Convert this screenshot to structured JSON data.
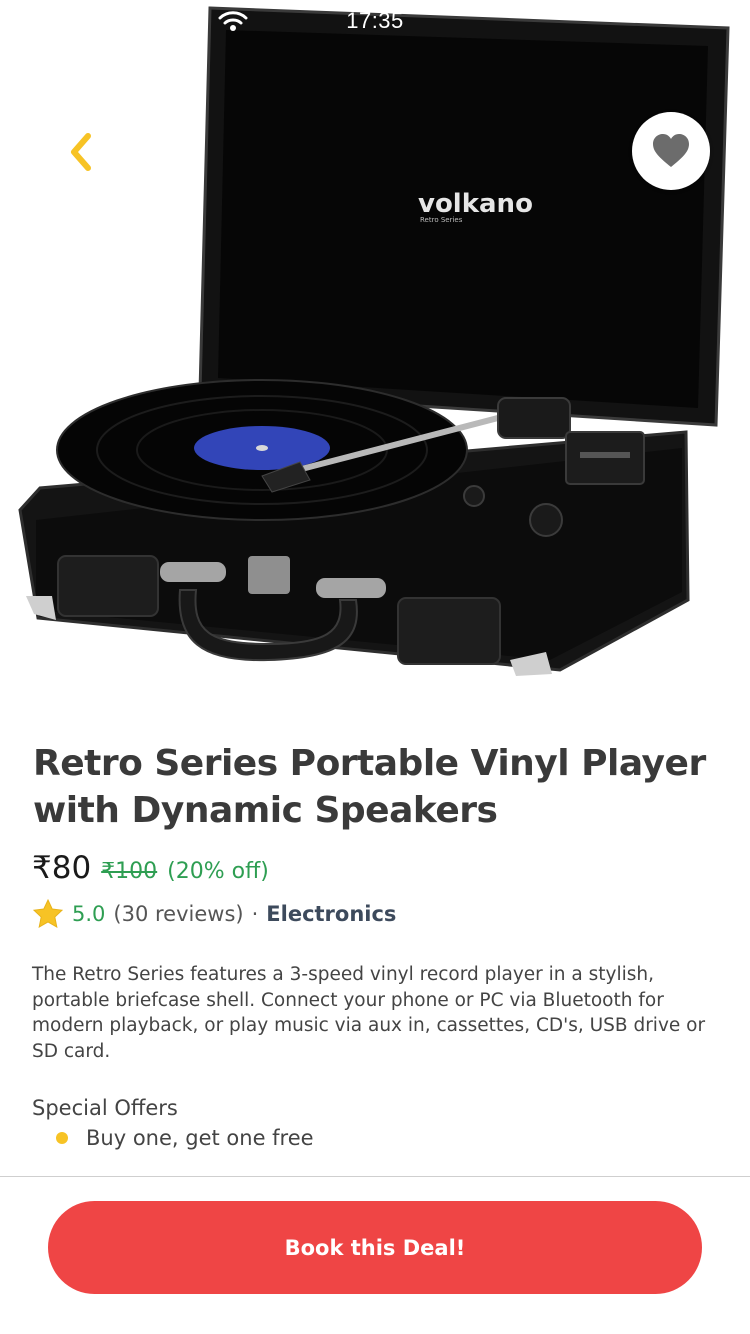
{
  "status_bar": {
    "time": "17:35"
  },
  "product": {
    "brand_logo": "volkano",
    "brand_sub": "Retro Series",
    "title": "Retro Series Portable Vinyl Player with Dynamic Speakers",
    "price": "₹80",
    "original_price": "₹100",
    "discount": "(20% off)",
    "rating": "5.0",
    "reviews": "(30 reviews)",
    "separator": "·",
    "category": "Electronics",
    "description": "The Retro Series features a 3-speed vinyl record player in a stylish, portable briefcase shell. Connect your phone or PC via Bluetooth for modern playback, or play music via aux in, cassettes, CD's, USB drive or SD card."
  },
  "offers": {
    "title": "Special Offers",
    "items": [
      "Buy one, get one free"
    ]
  },
  "cta": {
    "label": "Book this Deal!"
  },
  "icons": {
    "back": "chevron-left-icon",
    "favorite": "heart-icon",
    "star": "star-icon",
    "wifi": "wifi-icon"
  },
  "colors": {
    "accent_yellow": "#f7c325",
    "price_green": "#2e9e52",
    "cta_red": "#ef4545",
    "title_dark": "#3a3a3a"
  }
}
